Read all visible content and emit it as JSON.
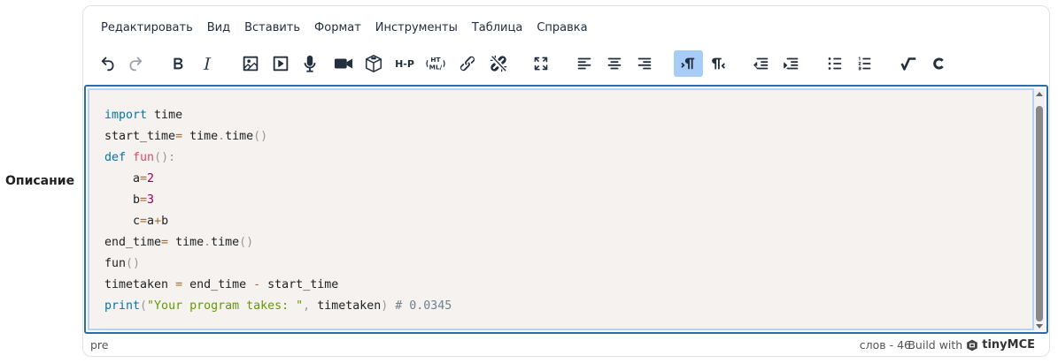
{
  "field": {
    "label": "Описание"
  },
  "menubar": [
    "Редактировать",
    "Вид",
    "Вставить",
    "Формат",
    "Инструменты",
    "Таблица",
    "Справка"
  ],
  "toolbar": {
    "buttons": [
      {
        "name": "undo-icon",
        "active": false,
        "disabled": false
      },
      {
        "name": "redo-icon",
        "active": false,
        "disabled": true
      },
      {
        "name": "bold-icon",
        "active": false,
        "disabled": false
      },
      {
        "name": "italic-icon",
        "active": false,
        "disabled": false
      },
      {
        "name": "image-icon",
        "active": false,
        "disabled": false
      },
      {
        "name": "media-icon",
        "active": false,
        "disabled": false
      },
      {
        "name": "microphone-icon",
        "active": false,
        "disabled": false
      },
      {
        "name": "video-camera-icon",
        "active": false,
        "disabled": false
      },
      {
        "name": "3d-box-icon",
        "active": false,
        "disabled": false
      },
      {
        "name": "h5p-icon",
        "active": false,
        "disabled": false
      },
      {
        "name": "html-icon",
        "active": false,
        "disabled": false
      },
      {
        "name": "link-icon",
        "active": false,
        "disabled": false
      },
      {
        "name": "unlink-icon",
        "active": false,
        "disabled": false
      },
      {
        "name": "fullscreen-icon",
        "active": false,
        "disabled": false
      },
      {
        "name": "align-left-icon",
        "active": false,
        "disabled": false
      },
      {
        "name": "align-center-icon",
        "active": false,
        "disabled": false
      },
      {
        "name": "align-right-icon",
        "active": false,
        "disabled": false
      },
      {
        "name": "ltr-icon",
        "active": true,
        "disabled": false
      },
      {
        "name": "rtl-icon",
        "active": false,
        "disabled": false
      },
      {
        "name": "outdent-icon",
        "active": false,
        "disabled": false
      },
      {
        "name": "indent-icon",
        "active": false,
        "disabled": false
      },
      {
        "name": "bullet-list-icon",
        "active": false,
        "disabled": false
      },
      {
        "name": "numbered-list-icon",
        "active": false,
        "disabled": false
      },
      {
        "name": "equation-icon",
        "active": false,
        "disabled": false
      },
      {
        "name": "code-c-icon",
        "active": false,
        "disabled": false
      }
    ],
    "h5p_text": "H-P",
    "html_text_top": "HT",
    "html_text_bottom": "ML/"
  },
  "code": {
    "lines": [
      [
        {
          "t": "import",
          "c": "kw"
        },
        {
          "t": " time",
          "c": ""
        }
      ],
      [
        {
          "t": "start_time",
          "c": ""
        },
        {
          "t": "=",
          "c": "op"
        },
        {
          "t": " time",
          "c": ""
        },
        {
          "t": ".",
          "c": "pun"
        },
        {
          "t": "time",
          "c": ""
        },
        {
          "t": "()",
          "c": "pun"
        }
      ],
      [
        {
          "t": "def",
          "c": "kw"
        },
        {
          "t": " ",
          "c": ""
        },
        {
          "t": "fun",
          "c": "fn"
        },
        {
          "t": "():",
          "c": "pun"
        }
      ],
      [
        {
          "t": "    a",
          "c": ""
        },
        {
          "t": "=",
          "c": "op"
        },
        {
          "t": "2",
          "c": "num"
        }
      ],
      [
        {
          "t": "    b",
          "c": ""
        },
        {
          "t": "=",
          "c": "op"
        },
        {
          "t": "3",
          "c": "num"
        }
      ],
      [
        {
          "t": "    c",
          "c": ""
        },
        {
          "t": "=",
          "c": "op"
        },
        {
          "t": "a",
          "c": ""
        },
        {
          "t": "+",
          "c": "op"
        },
        {
          "t": "b",
          "c": ""
        }
      ],
      [
        {
          "t": "end_time",
          "c": ""
        },
        {
          "t": "=",
          "c": "op"
        },
        {
          "t": " time",
          "c": ""
        },
        {
          "t": ".",
          "c": "pun"
        },
        {
          "t": "time",
          "c": ""
        },
        {
          "t": "()",
          "c": "pun"
        }
      ],
      [
        {
          "t": "fun",
          "c": ""
        },
        {
          "t": "()",
          "c": "pun"
        }
      ],
      [
        {
          "t": "timetaken ",
          "c": ""
        },
        {
          "t": "=",
          "c": "op"
        },
        {
          "t": " end_time ",
          "c": ""
        },
        {
          "t": "-",
          "c": "op"
        },
        {
          "t": " start_time",
          "c": ""
        }
      ],
      [
        {
          "t": "print",
          "c": "kw"
        },
        {
          "t": "(",
          "c": "pun"
        },
        {
          "t": "\"Your program takes: \"",
          "c": "str"
        },
        {
          "t": ",",
          "c": "pun"
        },
        {
          "t": " timetaken",
          "c": ""
        },
        {
          "t": ")",
          "c": "pun"
        },
        {
          "t": " # 0.0345",
          "c": "cm"
        }
      ]
    ]
  },
  "status": {
    "path": "pre",
    "word_count": "слов - 46",
    "build_with": "Build with",
    "brand": "tinyMCE"
  }
}
